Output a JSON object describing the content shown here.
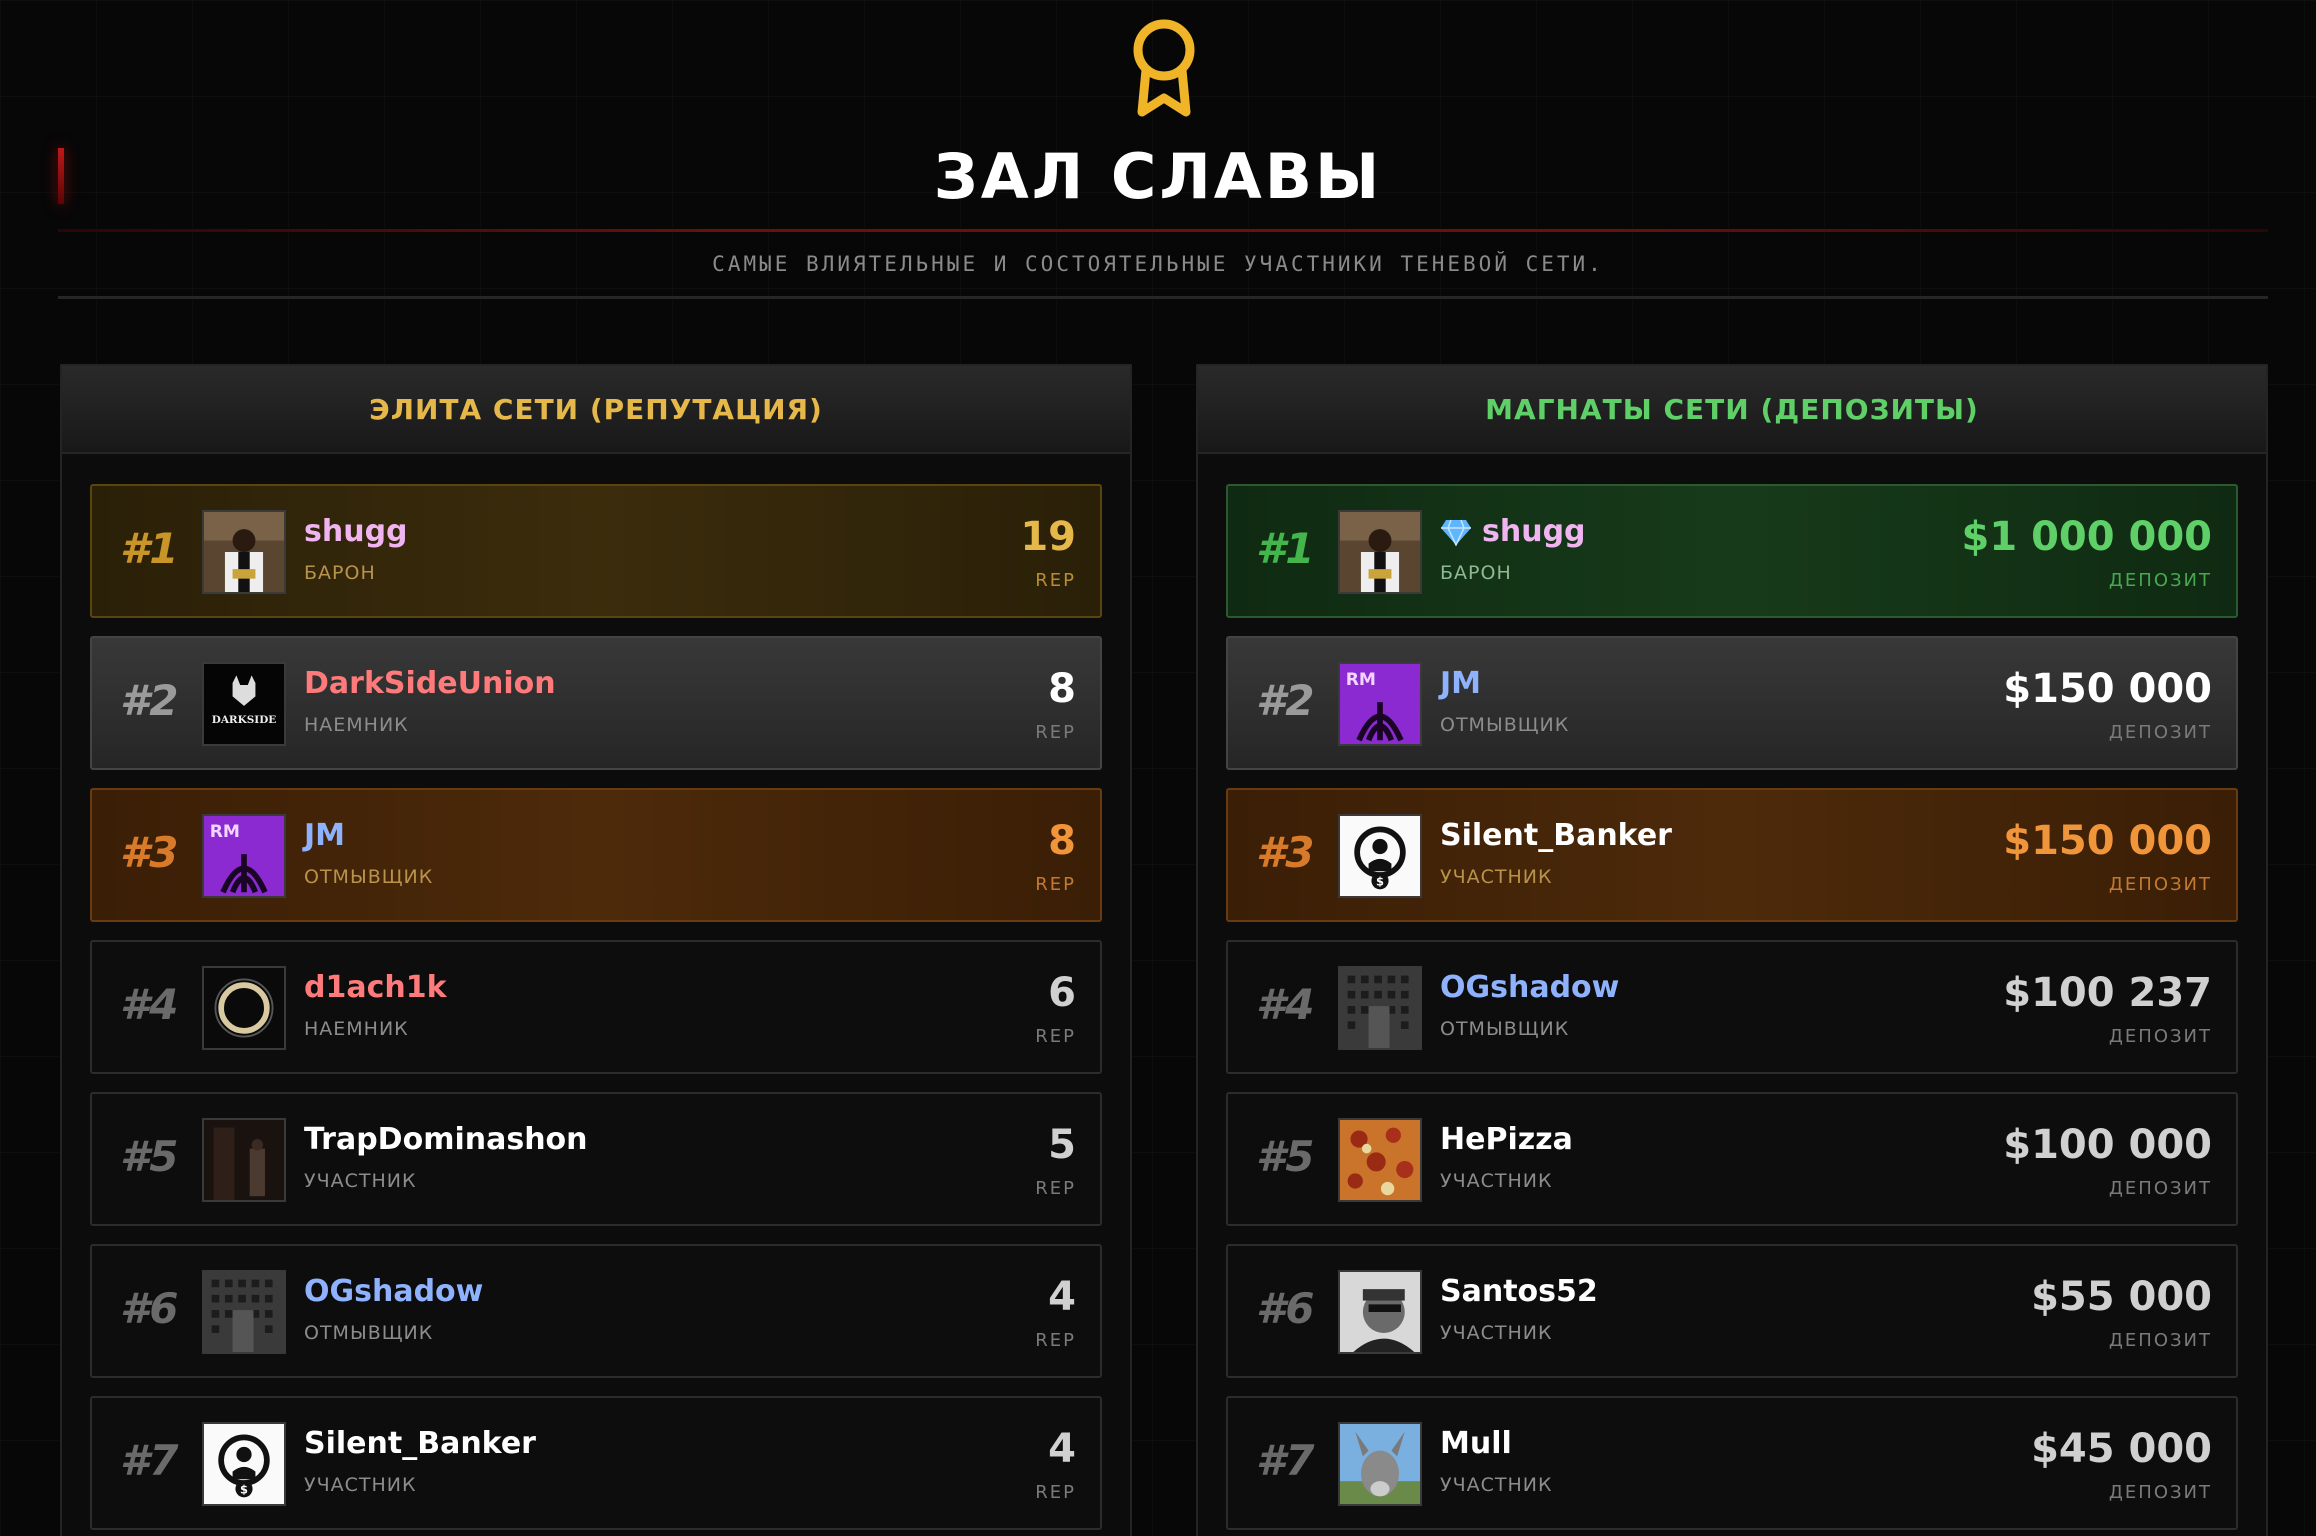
{
  "header": {
    "title": "ЗАЛ СЛАВЫ",
    "subtitle": "САМЫЕ ВЛИЯТЕЛЬНЫЕ И СОСТОЯТЕЛЬНЫЕ УЧАСТНИКИ ТЕНЕВОЙ СЕТИ.",
    "icon": "award-icon",
    "accent": "#f0b429"
  },
  "reputation": {
    "title": "ЭЛИТА СЕТИ (РЕПУТАЦИЯ)",
    "title_color": "#e6b84a",
    "rows": [
      {
        "rank": "#1",
        "name": "shugg",
        "role": "БАРОН",
        "value": "19",
        "unit": "REP",
        "avatar": "shugg-avatar"
      },
      {
        "rank": "#2",
        "name": "DarkSideUnion",
        "role": "НАЕМНИК",
        "value": "8",
        "unit": "REP",
        "avatar": "darkside-avatar"
      },
      {
        "rank": "#3",
        "name": "JM",
        "role": "ОТМЫВЩИК",
        "value": "8",
        "unit": "REP",
        "avatar": "jm-avatar"
      },
      {
        "rank": "#4",
        "name": "d1ach1k",
        "role": "НАЕМНИК",
        "value": "6",
        "unit": "REP",
        "avatar": "ring-avatar"
      },
      {
        "rank": "#5",
        "name": "TrapDominashon",
        "role": "УЧАСТНИК",
        "value": "5",
        "unit": "REP",
        "avatar": "dark-room-avatar"
      },
      {
        "rank": "#6",
        "name": "OGshadow",
        "role": "ОТМЫВЩИК",
        "value": "4",
        "unit": "REP",
        "avatar": "building-avatar"
      },
      {
        "rank": "#7",
        "name": "Silent_Banker",
        "role": "УЧАСТНИК",
        "value": "4",
        "unit": "REP",
        "avatar": "banker-logo-avatar"
      }
    ]
  },
  "deposits": {
    "title": "МАГНАТЫ СЕТИ (ДЕПОЗИТЫ)",
    "title_color": "#5ed067",
    "rows": [
      {
        "rank": "#1",
        "name": "shugg",
        "role": "БАРОН",
        "value": "$1 000 000",
        "unit": "ДЕПОЗИТ",
        "avatar": "shugg-avatar",
        "badge": "diamond-icon"
      },
      {
        "rank": "#2",
        "name": "JM",
        "role": "ОТМЫВЩИК",
        "value": "$150 000",
        "unit": "ДЕПОЗИТ",
        "avatar": "jm-avatar"
      },
      {
        "rank": "#3",
        "name": "Silent_Banker",
        "role": "УЧАСТНИК",
        "value": "$150 000",
        "unit": "ДЕПОЗИТ",
        "avatar": "banker-logo-avatar"
      },
      {
        "rank": "#4",
        "name": "OGshadow",
        "role": "ОТМЫВЩИК",
        "value": "$100 237",
        "unit": "ДЕПОЗИТ",
        "avatar": "building-avatar"
      },
      {
        "rank": "#5",
        "name": "HePizza",
        "role": "УЧАСТНИК",
        "value": "$100 000",
        "unit": "ДЕПОЗИТ",
        "avatar": "pizza-avatar"
      },
      {
        "rank": "#6",
        "name": "Santos52",
        "role": "УЧАСТНИК",
        "value": "$55 000",
        "unit": "ДЕПОЗИТ",
        "avatar": "portrait-avatar"
      },
      {
        "rank": "#7",
        "name": "Mull",
        "role": "УЧАСТНИК",
        "value": "$45 000",
        "unit": "ДЕПОЗИТ",
        "avatar": "donkey-avatar"
      }
    ]
  }
}
